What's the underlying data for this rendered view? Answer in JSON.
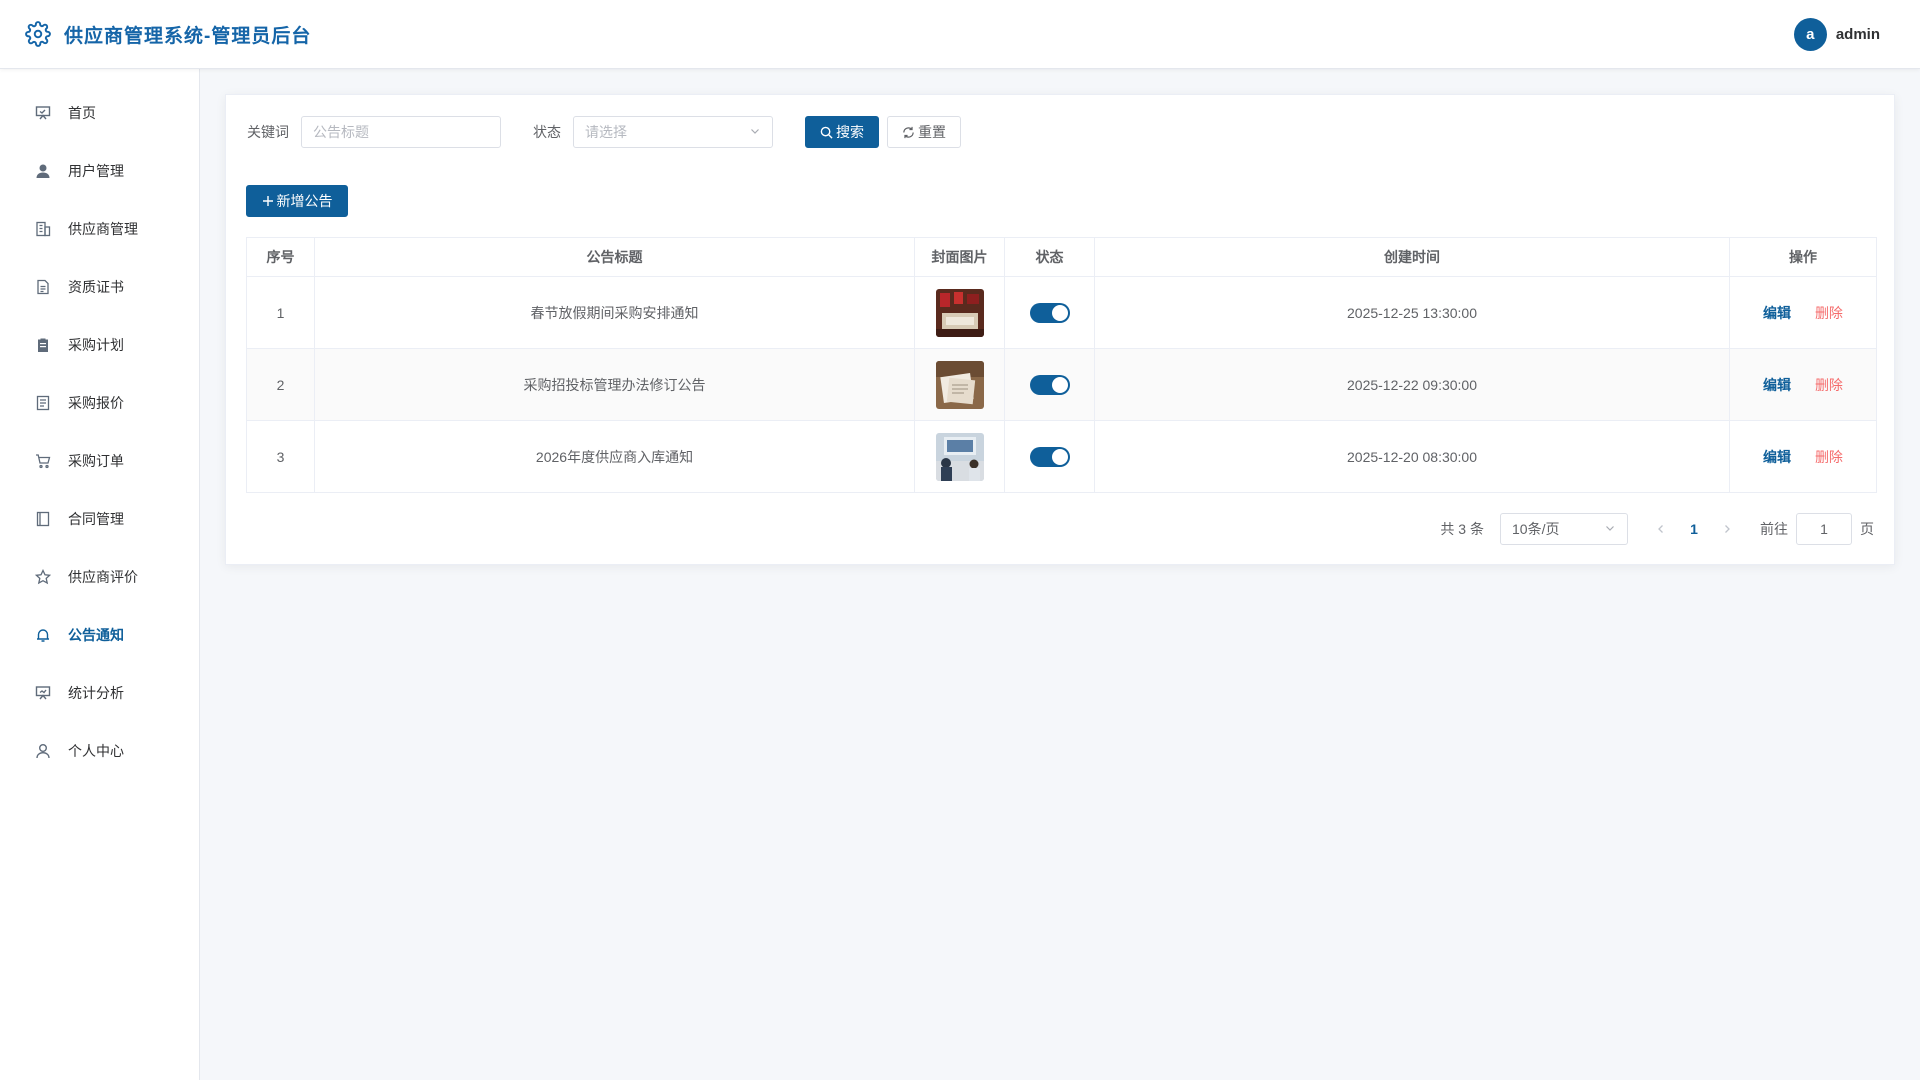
{
  "header": {
    "title": "供应商管理系统-管理员后台",
    "avatar_letter": "a",
    "username": "admin"
  },
  "sidebar": {
    "items": [
      {
        "label": "首页",
        "icon": "monitor-icon"
      },
      {
        "label": "用户管理",
        "icon": "user-filled-icon"
      },
      {
        "label": "供应商管理",
        "icon": "building-icon"
      },
      {
        "label": "资质证书",
        "icon": "document-icon"
      },
      {
        "label": "采购计划",
        "icon": "clipboard-icon"
      },
      {
        "label": "采购报价",
        "icon": "document-list-icon"
      },
      {
        "label": "采购订单",
        "icon": "cart-icon"
      },
      {
        "label": "合同管理",
        "icon": "notebook-icon"
      },
      {
        "label": "供应商评价",
        "icon": "star-icon"
      },
      {
        "label": "公告通知",
        "icon": "bell-icon",
        "active": true
      },
      {
        "label": "统计分析",
        "icon": "chart-board-icon"
      },
      {
        "label": "个人中心",
        "icon": "user-icon"
      }
    ]
  },
  "filters": {
    "keyword_label": "关键词",
    "keyword_placeholder": "公告标题",
    "status_label": "状态",
    "status_placeholder": "请选择",
    "search_label": "搜索",
    "reset_label": "重置"
  },
  "add_button_label": "新增公告",
  "table": {
    "columns": [
      "序号",
      "公告标题",
      "封面图片",
      "状态",
      "创建时间",
      "操作"
    ],
    "rows": [
      {
        "index": "1",
        "title": "春节放假期间采购安排通知",
        "status_on": true,
        "created": "2025-12-25 13:30:00",
        "edit": "编辑",
        "delete": "删除"
      },
      {
        "index": "2",
        "title": "采购招投标管理办法修订公告",
        "status_on": true,
        "created": "2025-12-22 09:30:00",
        "edit": "编辑",
        "delete": "删除"
      },
      {
        "index": "3",
        "title": "2026年度供应商入库通知",
        "status_on": true,
        "created": "2025-12-20 08:30:00",
        "edit": "编辑",
        "delete": "删除"
      }
    ]
  },
  "pagination": {
    "total_text": "共 3 条",
    "page_size": "10条/页",
    "current_page": "1",
    "goto_label": "前往",
    "goto_value": "1",
    "page_suffix": "页"
  },
  "colors": {
    "primary": "#0f5f9a",
    "danger": "#f56c6c",
    "background": "#f5f7fa"
  }
}
